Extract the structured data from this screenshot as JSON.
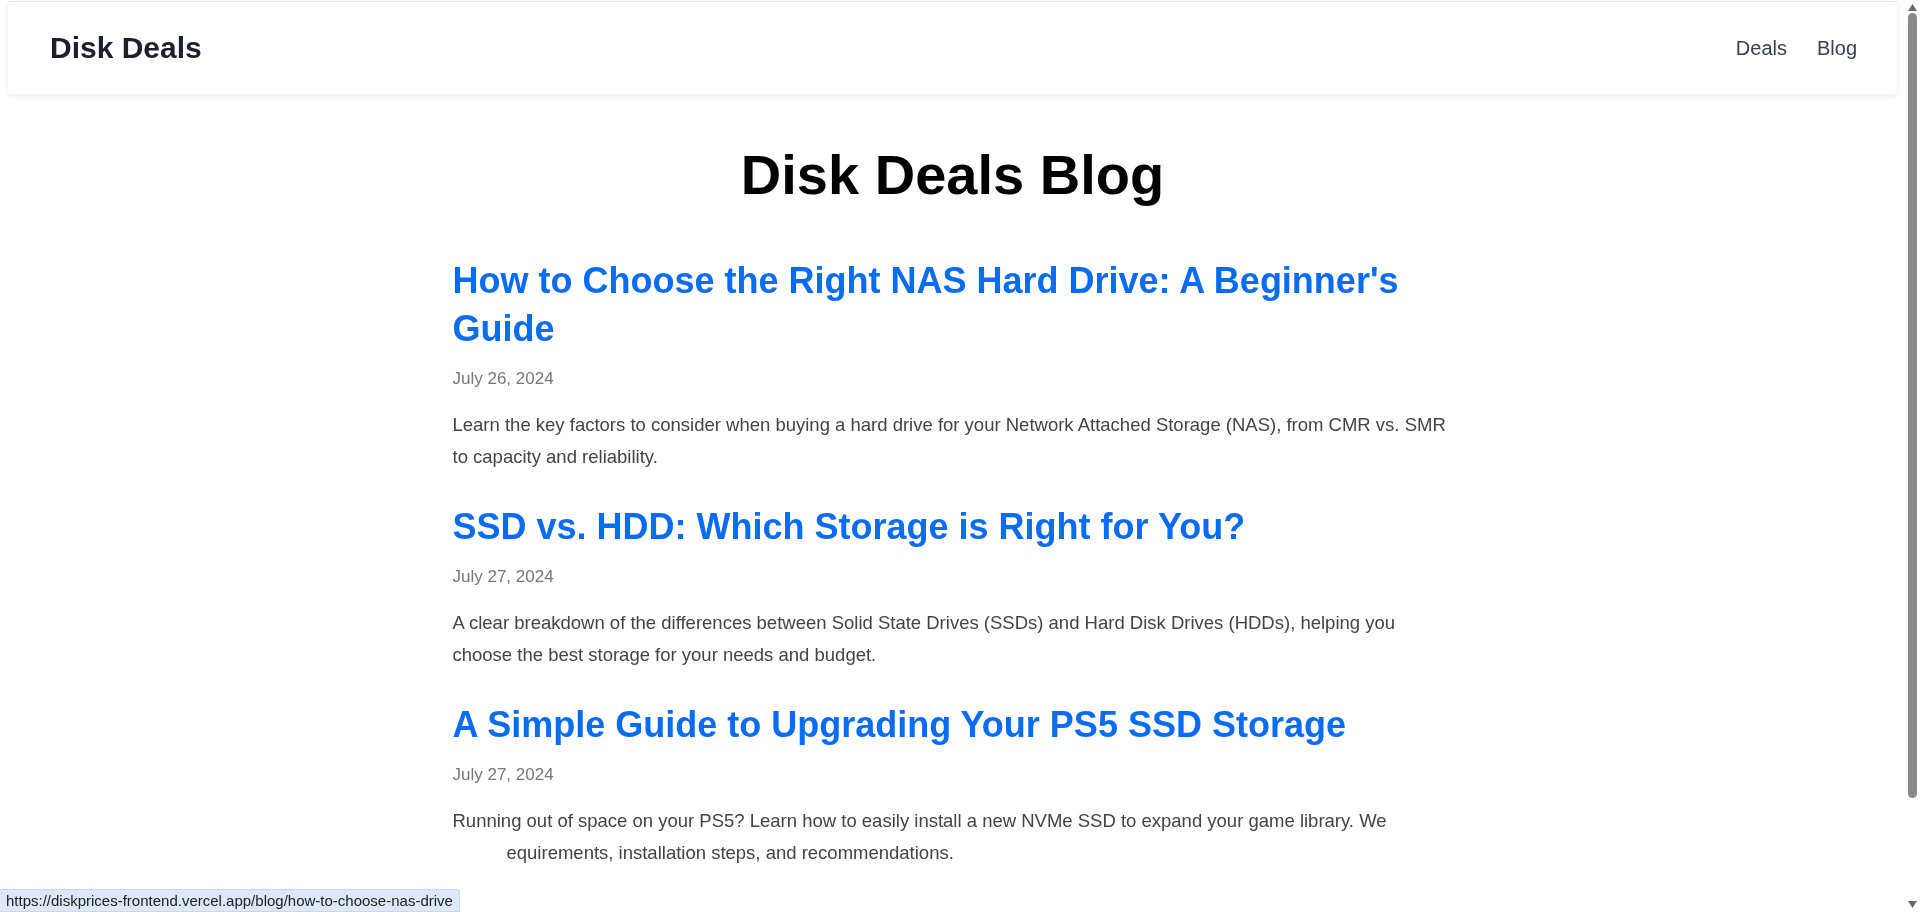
{
  "header": {
    "logo": "Disk Deals",
    "nav": [
      "Deals",
      "Blog"
    ]
  },
  "page_title": "Disk Deals Blog",
  "posts": [
    {
      "title": "How to Choose the Right NAS Hard Drive: A Beginner's Guide",
      "date": "July 26, 2024",
      "excerpt": [
        "Learn the key factors to consider when buying a hard drive for your Network Attached Storage (NAS), from CMR vs. SMR to capacity and reliability."
      ]
    },
    {
      "title": "SSD vs. HDD: Which Storage is Right for You?",
      "date": "July 27, 2024",
      "excerpt": [
        "A clear breakdown of the differences between Solid State Drives (SSDs) and Hard Disk Drives (HDDs), helping you choose the best storage for your needs and budget."
      ]
    },
    {
      "title": "A Simple Guide to Upgrading Your PS5 SSD Storage",
      "date": "July 27, 2024",
      "excerpt": [
        "Running out of space on your PS5? Learn how to easily install a new NVMe SSD to expand your game library. We",
        "equirements, installation steps, and recommendations."
      ]
    }
  ],
  "status_bar": {
    "url": "https://diskprices-frontend.vercel.app/blog/how-to-choose-nas-drive"
  }
}
